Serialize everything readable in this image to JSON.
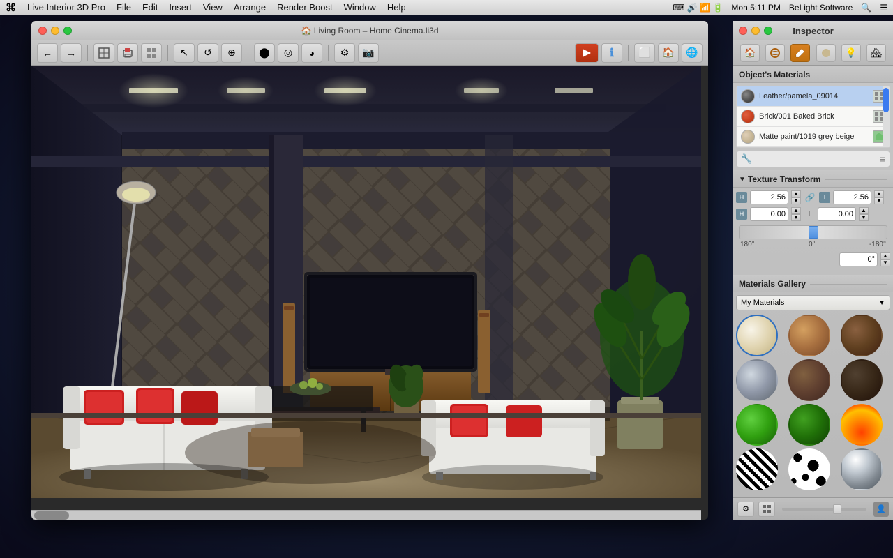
{
  "app": {
    "name": "Live Interior 3D Pro",
    "version": "Pro"
  },
  "menubar": {
    "apple": "⌘",
    "items": [
      "Live Interior 3D Pro",
      "File",
      "Edit",
      "Insert",
      "View",
      "Arrange",
      "Render Boost",
      "Window",
      "Help"
    ],
    "right_info": "U.S.  Mon 5:11 PM  BeLight Software",
    "time": "Mon 5:11 PM",
    "brand": "BeLight Software"
  },
  "main_window": {
    "title": "Living Room – Home Cinema.li3d",
    "traffic_lights": [
      "close",
      "minimize",
      "maximize"
    ],
    "scrollbar_label": "scroll"
  },
  "toolbar": {
    "buttons": [
      "←",
      "→",
      "grid",
      "print",
      "layout",
      "select",
      "pan",
      "orbit",
      "record",
      "camera",
      "render",
      "info",
      "frame",
      "home",
      "scene"
    ]
  },
  "inspector": {
    "title": "Inspector",
    "traffic_lights": [
      "close",
      "minimize",
      "maximize"
    ],
    "toolbar_buttons": [
      "house-icon",
      "sphere-icon",
      "brush-icon",
      "material-icon",
      "light-icon",
      "scene-icon"
    ],
    "active_tab": 3,
    "objects_materials_label": "Object's Materials",
    "materials": [
      {
        "name": "Leather/pamela_09014",
        "swatch_color": "#555555",
        "icon": "grid"
      },
      {
        "name": "Brick/001 Baked Brick",
        "swatch_color": "#cc4422",
        "icon": "grid"
      },
      {
        "name": "Matte paint/1019 grey beige",
        "swatch_color": "#c8b898",
        "icon": "green"
      }
    ],
    "texture_transform": {
      "label": "Texture Transform",
      "scale_x_label": "H",
      "scale_x_value": "2.56",
      "scale_y_label": "I",
      "scale_y_value": "2.56",
      "offset_x_label": "H",
      "offset_x_value": "0.00",
      "offset_y_label": "I",
      "offset_y_value": "0.00",
      "rotation_value": "0°",
      "rotation_min": "180°",
      "rotation_zero": "0°",
      "rotation_max": "-180°"
    },
    "gallery": {
      "label": "Materials Gallery",
      "dropdown_value": "My Materials",
      "materials": [
        {
          "id": "cream",
          "style": "mat-cream"
        },
        {
          "id": "wood-light",
          "style": "mat-wood-light"
        },
        {
          "id": "wood-dark-brick",
          "style": "mat-wood-dark"
        },
        {
          "id": "metal",
          "style": "mat-metal"
        },
        {
          "id": "brown",
          "style": "mat-brown"
        },
        {
          "id": "dark-brown",
          "style": "mat-dark-brown"
        },
        {
          "id": "green-bright",
          "style": "mat-green-bright"
        },
        {
          "id": "green-dark",
          "style": "mat-green-dark"
        },
        {
          "id": "fire",
          "style": "mat-fire"
        },
        {
          "id": "zebra",
          "style": "mat-zebra"
        },
        {
          "id": "spots",
          "style": "mat-spots"
        },
        {
          "id": "chrome",
          "style": "mat-chrome"
        }
      ]
    }
  },
  "scene": {
    "description": "Living room 3D render with stone wall, white sofas, TV unit, plants"
  }
}
